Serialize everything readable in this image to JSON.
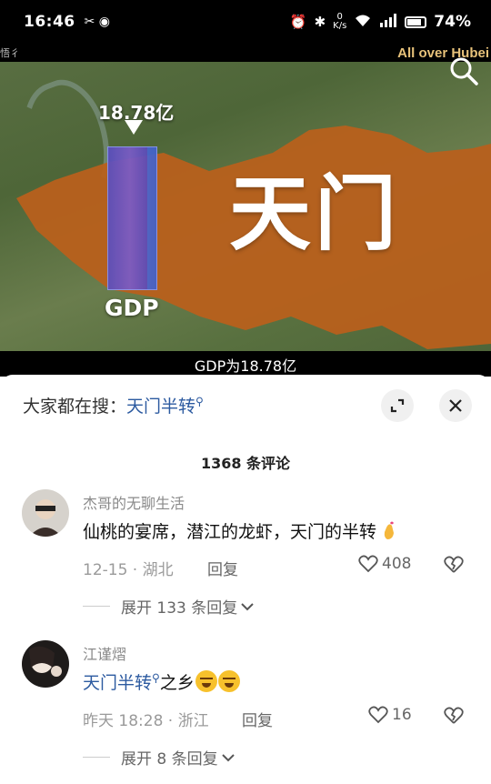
{
  "status_bar": {
    "time": "16:46",
    "net_speed_value": "0",
    "net_speed_unit": "K/s",
    "battery": "74%"
  },
  "video": {
    "channel": "All over Hubei",
    "corner_mark": "悟彳",
    "city_name": "天门",
    "gdp_value": "18.78亿",
    "gdp_label": "GDP",
    "subtitle": "GDP为18.78亿",
    "region_color": "#b8601c"
  },
  "comments_panel": {
    "search_prefix": "大家都在搜：",
    "search_term": "天门半转",
    "count_label": "1368 条评论",
    "comments": [
      {
        "user": "杰哥的无聊生活",
        "text": "仙桃的宴席，潜江的龙虾，天门的半转",
        "meta": "12-15 · 湖北",
        "reply": "回复",
        "likes": "408",
        "expand": "展开 133 条回复"
      },
      {
        "user": "江谨熠",
        "text_link": "天门半转",
        "text_rest": "之乡",
        "meta": "昨天 18:28 · 浙江",
        "reply": "回复",
        "likes": "16",
        "expand": "展开 8 条回复"
      }
    ]
  }
}
